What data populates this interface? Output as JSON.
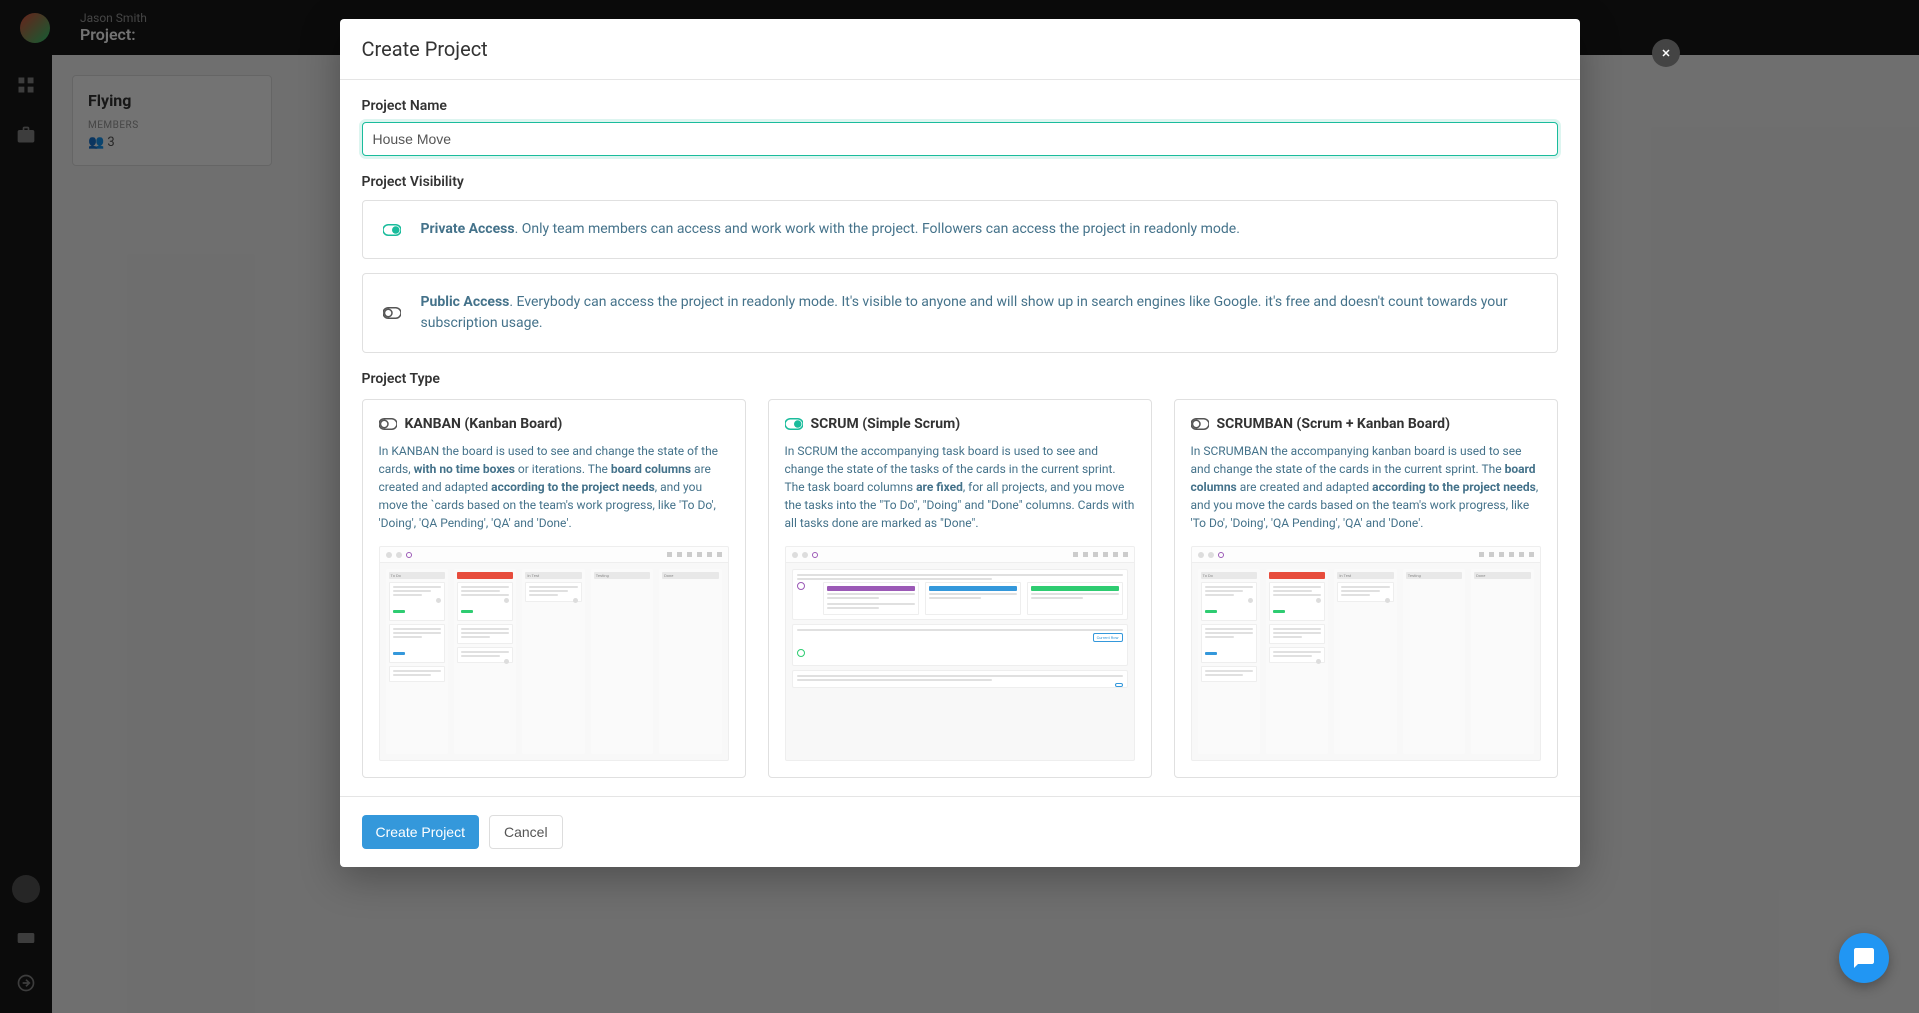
{
  "app": {
    "user_name": "Jason Smith",
    "breadcrumb": "Project:",
    "bg_card_title": "Flying",
    "bg_members_label": "MEMBERS",
    "bg_members_count": "3"
  },
  "modal": {
    "title": "Create Project",
    "project_name_label": "Project Name",
    "project_name_value": "House Move",
    "visibility_label": "Project Visibility",
    "private": {
      "title": "Private Access",
      "desc": ". Only team members can access and work work with the project. Followers can access the project in readonly mode."
    },
    "public": {
      "title": "Public Access",
      "desc": ". Everybody can access the project in readonly mode. It's visible to anyone and will show up in search engines like Google. it's free and doesn't count towards your subscription usage."
    },
    "type_label": "Project Type",
    "types": {
      "kanban": {
        "title": "KANBAN (Kanban Board)",
        "desc_1": "In KANBAN the board is used to see and change the state of the cards, ",
        "desc_2": "with no time boxes",
        "desc_3": " or iterations. The ",
        "desc_4": "board columns",
        "desc_5": " are created and adapted ",
        "desc_6": "according to the project needs",
        "desc_7": ", and you move the `cards based on the team's work progress, like 'To Do', 'Doing', 'QA Pending', 'QA' and 'Done'."
      },
      "scrum": {
        "title": "SCRUM (Simple Scrum)",
        "desc_1": "In SCRUM the accompanying task board is used to see and change the state of the tasks of the cards in the current sprint. The task board columns ",
        "desc_2": "are fixed",
        "desc_3": ", for all projects, and you move the tasks into the \"To Do\", \"Doing\" and \"Done\" columns. Cards with all tasks done are marked as \"Done\"."
      },
      "scrumban": {
        "title": "SCRUMBAN (Scrum + Kanban Board)",
        "desc_1": "In SCRUMBAN the accompanying kanban board is used to see and change the state of the cards in the current sprint. The ",
        "desc_2": "board columns",
        "desc_3": " are created and adapted ",
        "desc_4": "according to the project needs",
        "desc_5": ", and you move the cards based on the team's work progress, like 'To Do', 'Doing', 'QA Pending', 'QA' and 'Done'."
      }
    },
    "create_btn": "Create Project",
    "cancel_btn": "Cancel"
  }
}
